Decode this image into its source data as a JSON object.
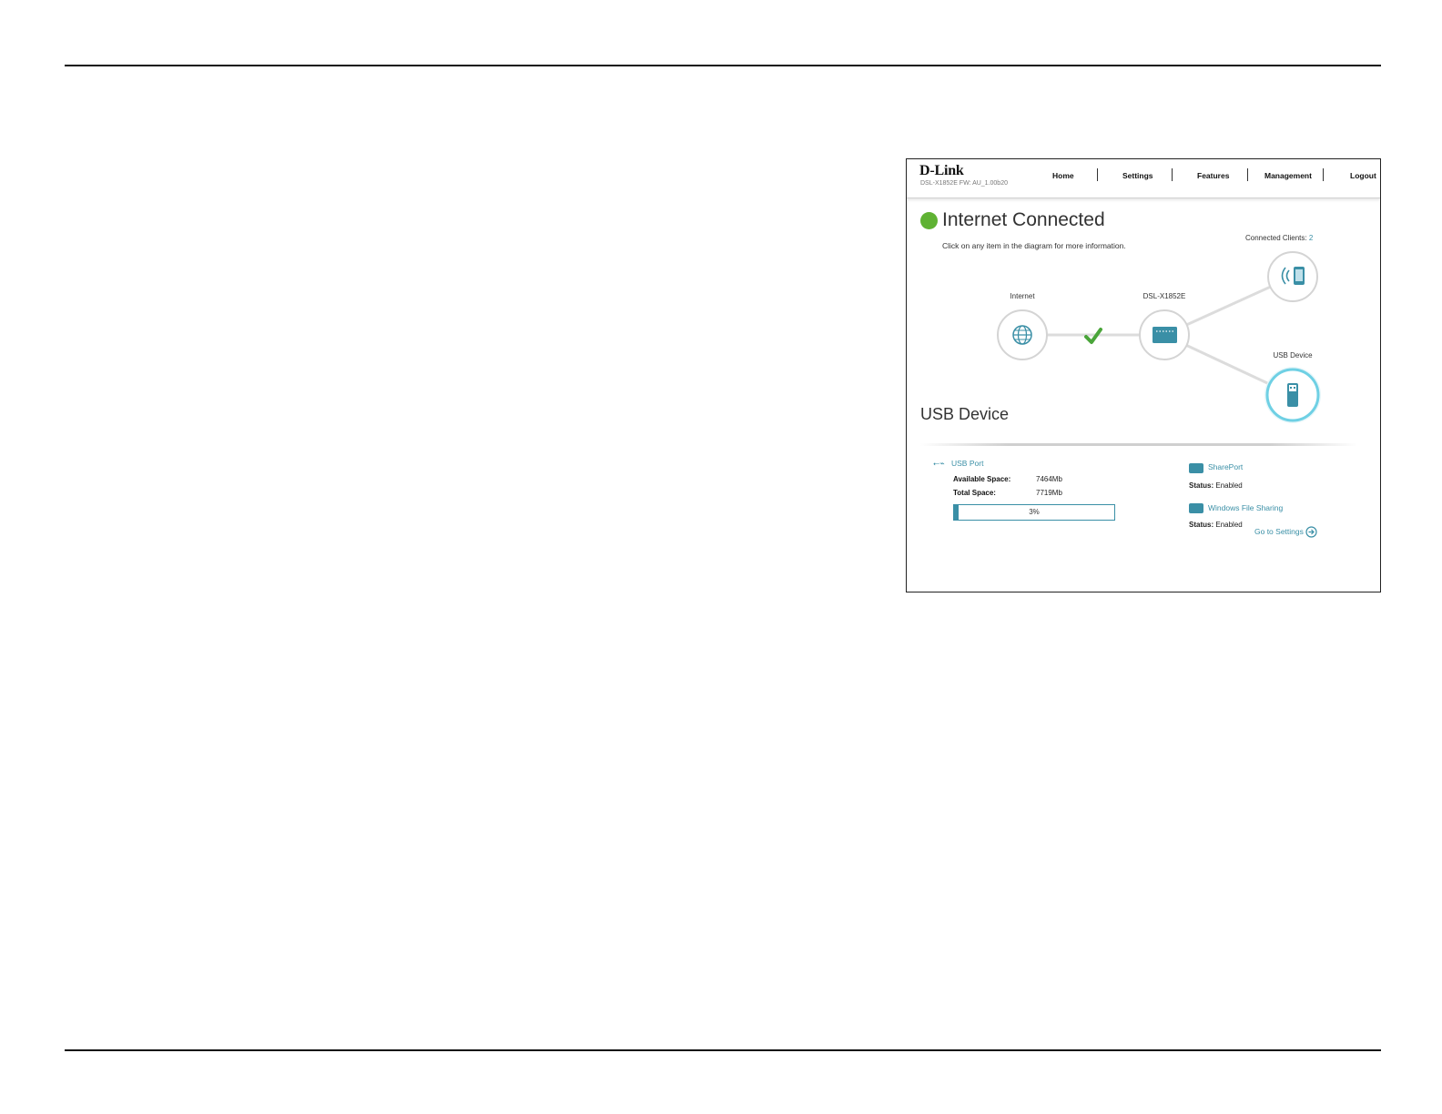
{
  "header": {
    "logo": "D-Link",
    "subtitle": "DSL-X1852E  FW: AU_1.00b20",
    "nav": [
      "Home",
      "Settings",
      "Features",
      "Management",
      "Logout"
    ]
  },
  "status": {
    "title": "Internet Connected",
    "hint": "Click on any item in the diagram for more information."
  },
  "diagram": {
    "internet_label": "Internet",
    "router_label": "DSL-X1852E",
    "clients_label": "Connected Clients:",
    "clients_count": "2",
    "usb_label": "USB Device"
  },
  "usb_section": {
    "title": "USB Device",
    "port_label": "USB Port",
    "available_label": "Available Space:",
    "available_value": "7464Mb",
    "total_label": "Total Space:",
    "total_value": "7719Mb",
    "usage_text": "3%",
    "usage_fraction": 0.03,
    "shareport_label": "SharePort",
    "shareport_status_label": "Status:",
    "shareport_status_value": "Enabled",
    "wfs_label": "Windows File Sharing",
    "wfs_status_label": "Status:",
    "wfs_status_value": "Enabled",
    "goto_label": "Go to Settings"
  },
  "colors": {
    "accent": "#3a8fa6",
    "connected": "#5fb233",
    "check": "#4aa53a"
  }
}
